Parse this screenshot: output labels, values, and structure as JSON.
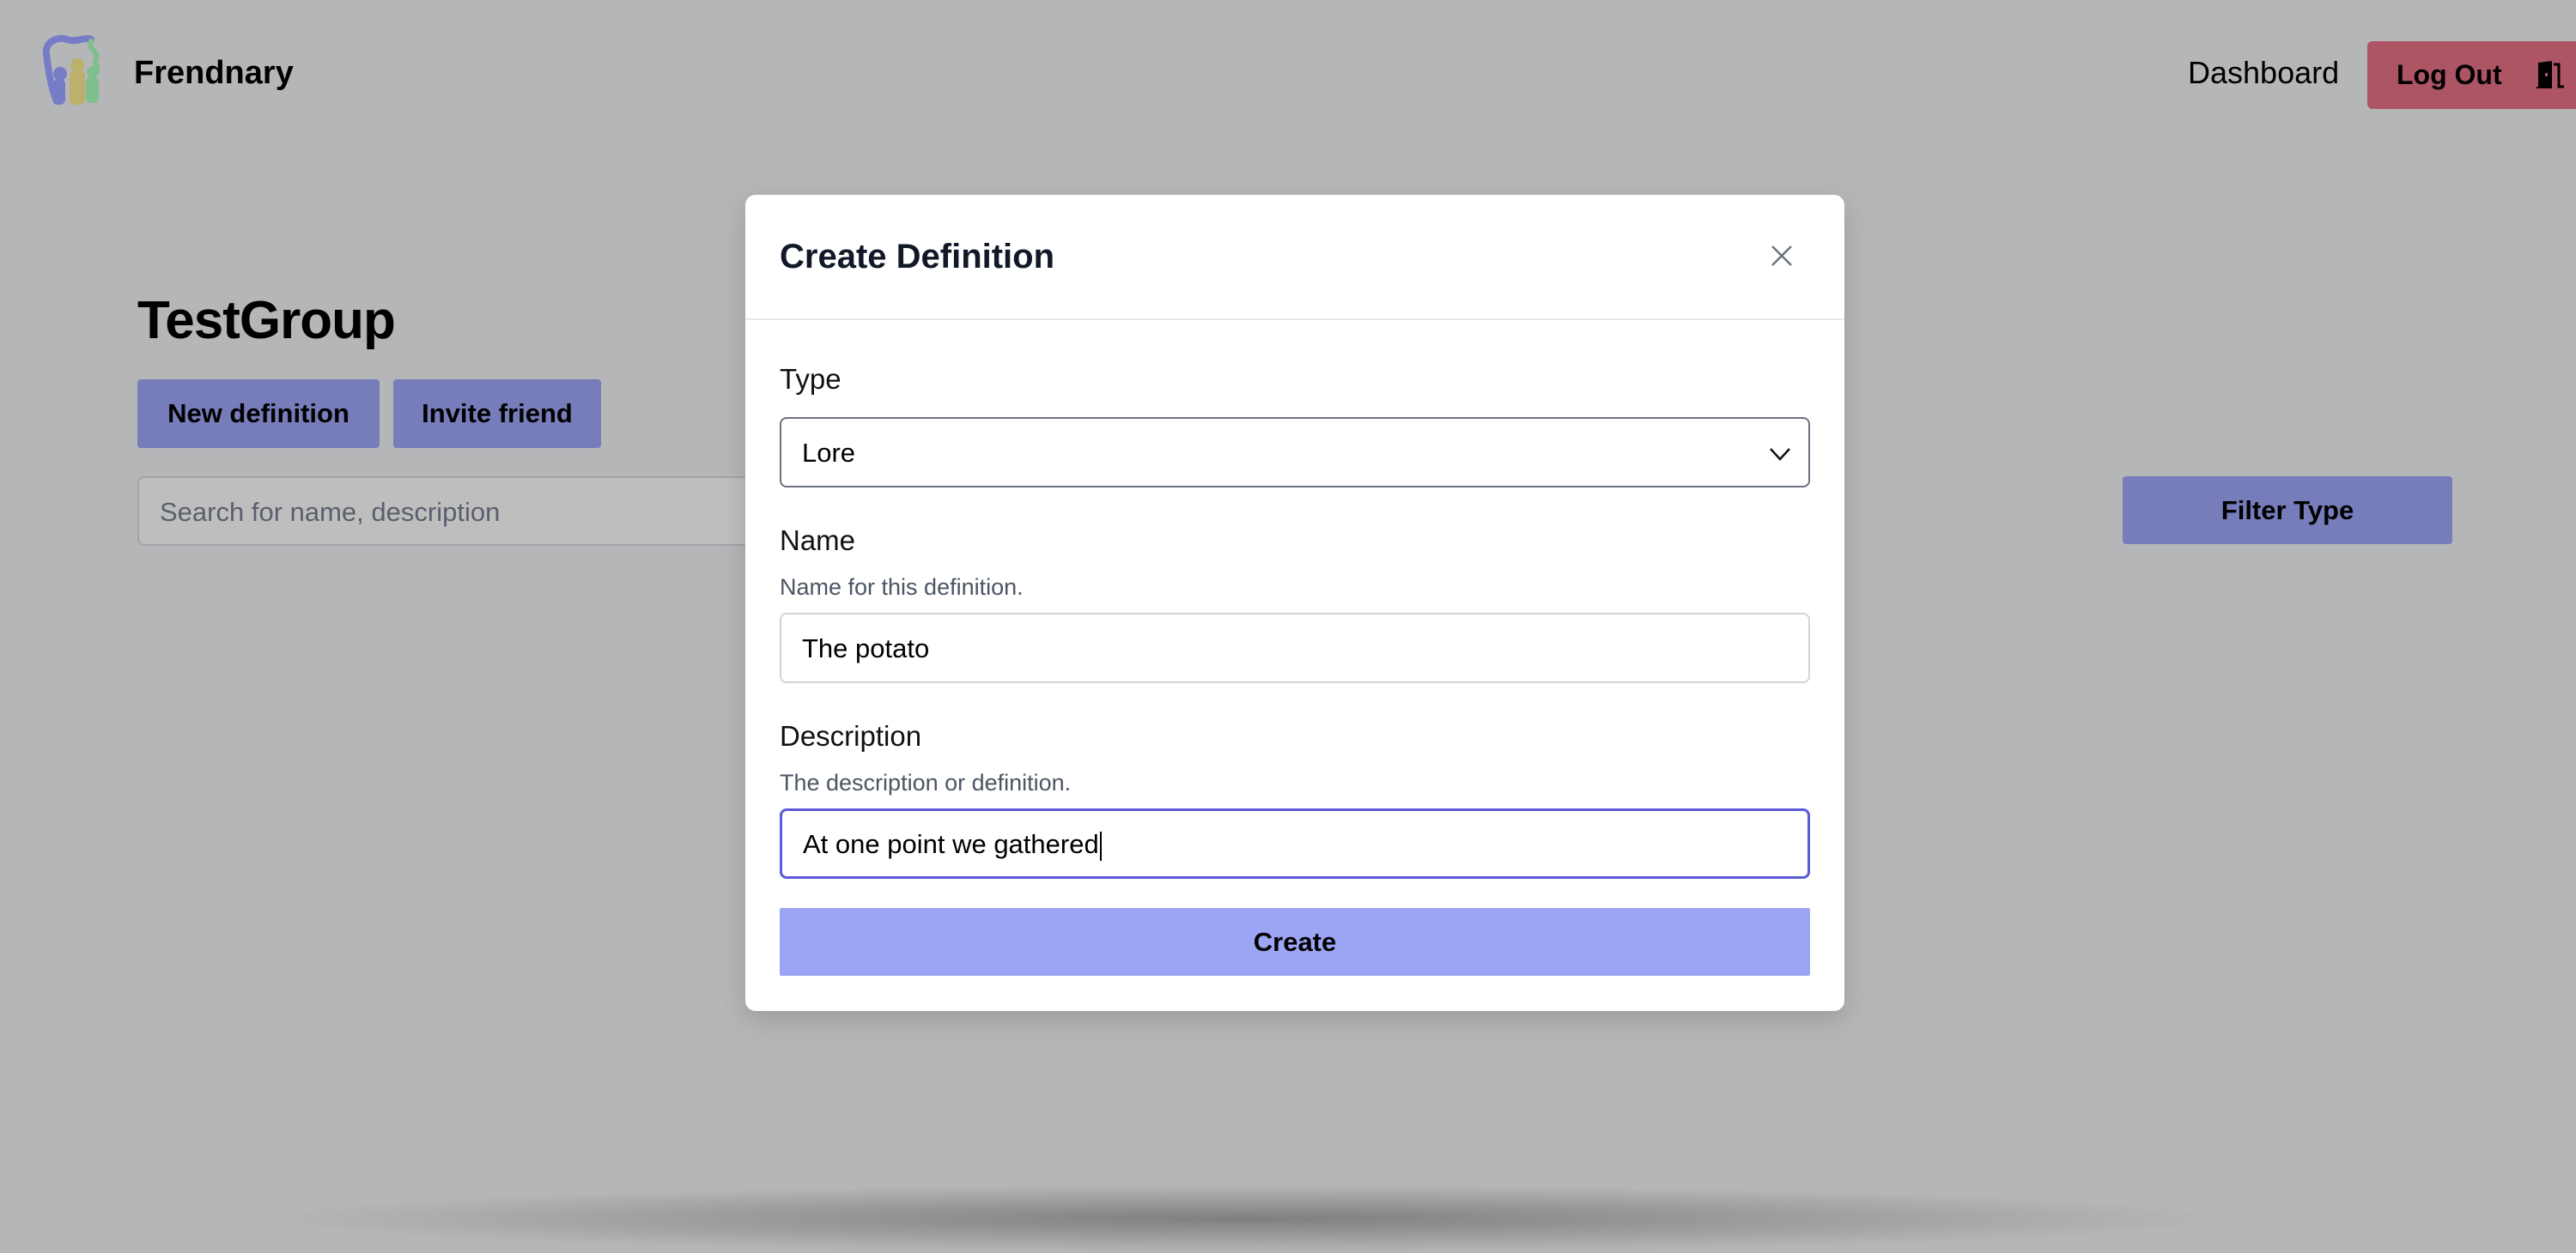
{
  "header": {
    "brand": "Frendnary",
    "logo_icon": "people-family-logo",
    "nav_dashboard": "Dashboard",
    "logout_label": "Log Out",
    "logout_icon": "door-exit-icon",
    "logout_color": "#ae5565"
  },
  "page": {
    "title": "TestGroup",
    "new_definition_label": "New definition",
    "invite_friend_label": "Invite friend",
    "search_placeholder": "Search for name, description",
    "filter_type_label": "Filter Type",
    "accent_color": "#777cba"
  },
  "modal": {
    "title": "Create Definition",
    "close_icon": "close-icon",
    "type_label": "Type",
    "type_value": "Lore",
    "name_label": "Name",
    "name_help": "Name for this definition.",
    "name_value": "The potato",
    "description_label": "Description",
    "description_help": "The description or definition.",
    "description_value": "At one point we gathered",
    "create_label": "Create",
    "create_color": "#9ca5f4",
    "focus_color": "#5b5bd6"
  }
}
